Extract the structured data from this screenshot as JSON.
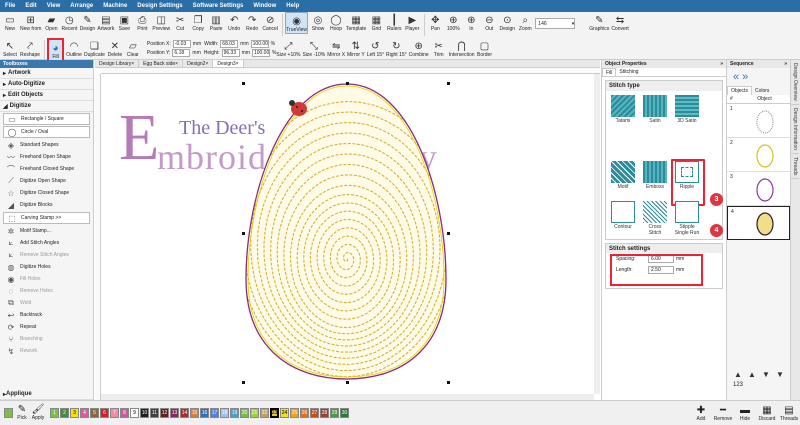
{
  "menu": [
    "File",
    "Edit",
    "View",
    "Arrange",
    "Machine",
    "Design Settings",
    "Software Settings",
    "Window",
    "Help"
  ],
  "toolbar1": [
    {
      "label": "New",
      "icon": "new-icon"
    },
    {
      "label": "New from",
      "icon": "new-from-icon"
    },
    {
      "label": "Open",
      "icon": "open-icon"
    },
    {
      "label": "Recent",
      "icon": "recent-icon"
    },
    {
      "label": "Design",
      "icon": "design-icon"
    },
    {
      "label": "Artwork",
      "icon": "artwork-icon"
    },
    {
      "label": "Save",
      "icon": "save-icon"
    },
    {
      "label": "Print",
      "icon": "print-icon"
    },
    {
      "label": "Preview",
      "icon": "preview-icon"
    },
    {
      "label": "Cut",
      "icon": "cut-icon"
    },
    {
      "label": "Copy",
      "icon": "copy-icon"
    },
    {
      "label": "Paste",
      "icon": "paste-icon"
    },
    {
      "label": "Undo",
      "icon": "undo-icon"
    },
    {
      "label": "Redo",
      "icon": "redo-icon"
    },
    {
      "label": "Cancel",
      "icon": "cancel-icon"
    },
    {
      "label": "TrueView",
      "icon": "trueview-icon"
    },
    {
      "label": "Show",
      "icon": "show-icon"
    },
    {
      "label": "Hoop",
      "icon": "hoop-icon"
    },
    {
      "label": "Template",
      "icon": "template-icon"
    },
    {
      "label": "Grid",
      "icon": "grid-icon"
    },
    {
      "label": "Rulers",
      "icon": "rulers-icon"
    },
    {
      "label": "Player",
      "icon": "player-icon"
    },
    {
      "label": "Pan",
      "icon": "pan-icon"
    },
    {
      "label": "100%",
      "icon": "zoom100-icon"
    },
    {
      "label": "In",
      "icon": "zoom-in-icon"
    },
    {
      "label": "Out",
      "icon": "zoom-out-icon"
    },
    {
      "label": "Design",
      "icon": "zoom-design-icon"
    },
    {
      "label": "Zoom",
      "icon": "zoom-icon"
    }
  ],
  "zoom_value": "146",
  "toolbar1_right": [
    {
      "label": "Graphics",
      "icon": "graphics-icon"
    },
    {
      "label": "Convert",
      "icon": "convert-icon"
    }
  ],
  "toolbar2": [
    {
      "label": "Select",
      "icon": "select-icon"
    },
    {
      "label": "Reshape",
      "icon": "reshape-icon"
    },
    {
      "label": "Fill",
      "icon": "fill-icon"
    },
    {
      "label": "Outline",
      "icon": "outline-icon"
    },
    {
      "label": "Duplicate",
      "icon": "duplicate-icon"
    },
    {
      "label": "Delete",
      "icon": "delete-icon"
    },
    {
      "label": "Clear",
      "icon": "clear-icon"
    }
  ],
  "position": {
    "x_label": "Position X:",
    "x_value": "-0.03",
    "y_label": "Position Y:",
    "y_value": "6.18",
    "unit": "mm",
    "w_label": "Width:",
    "w_value": "68.03",
    "h_label": "Height:",
    "h_value": "96.33",
    "w_pct": "100.00",
    "h_pct": "100.00",
    "pct": "%"
  },
  "toolbar2_right": [
    {
      "label": "Size +10%",
      "icon": "size-up-icon"
    },
    {
      "label": "Size -10%",
      "icon": "size-down-icon"
    },
    {
      "label": "Mirror X",
      "icon": "mirror-x-icon"
    },
    {
      "label": "Mirror Y",
      "icon": "mirror-y-icon"
    },
    {
      "label": "Left 15°",
      "icon": "rotate-left-icon"
    },
    {
      "label": "Right 15°",
      "icon": "rotate-right-icon"
    },
    {
      "label": "Combine",
      "icon": "combine-icon"
    },
    {
      "label": "Trim",
      "icon": "trim-icon"
    },
    {
      "label": "Intersection",
      "icon": "intersection-icon"
    },
    {
      "label": "Border",
      "icon": "border-icon"
    }
  ],
  "toolboxes": {
    "title": "Toolboxes",
    "sections": [
      "Artwork",
      "Auto-Digitize",
      "Edit Objects",
      "Digitize"
    ],
    "items": [
      {
        "label": "Rectangle / Square",
        "icon": "rectangle-icon",
        "hl": true
      },
      {
        "label": "Circle / Oval",
        "icon": "circle-icon",
        "hl": true
      },
      {
        "label": "Standard Shapes",
        "icon": "shapes-icon",
        "hl": false
      },
      {
        "label": "Freehand Open Shape",
        "icon": "freehand-open-icon",
        "hl": false
      },
      {
        "label": "Freehand Closed Shape",
        "icon": "freehand-closed-icon",
        "hl": false
      },
      {
        "label": "Digitize Open Shape",
        "icon": "digitize-open-icon",
        "hl": false
      },
      {
        "label": "Digitize Closed Shape",
        "icon": "digitize-closed-icon",
        "hl": false
      },
      {
        "label": "Digitize Blocks",
        "icon": "digitize-blocks-icon",
        "hl": false
      },
      {
        "label": "Carving Stamp >>",
        "icon": "carving-stamp-icon",
        "hl": true
      },
      {
        "label": "Motif Stamp...",
        "icon": "motif-stamp-icon",
        "hl": false
      },
      {
        "label": "Add Stitch Angles",
        "icon": "add-angles-icon",
        "hl": false
      },
      {
        "label": "Remove Stitch Angles",
        "icon": "remove-angles-icon",
        "hl": false,
        "dim": true
      },
      {
        "label": "Digitize Holes",
        "icon": "digitize-holes-icon",
        "hl": false
      },
      {
        "label": "Fill Holes",
        "icon": "fill-holes-icon",
        "hl": false,
        "dim": true
      },
      {
        "label": "Remove Holes",
        "icon": "remove-holes-icon",
        "hl": false,
        "dim": true
      },
      {
        "label": "Weld",
        "icon": "weld-icon",
        "hl": false,
        "dim": true
      },
      {
        "label": "Backtrack",
        "icon": "backtrack-icon",
        "hl": false
      },
      {
        "label": "Repeat",
        "icon": "repeat-icon",
        "hl": false
      },
      {
        "label": "Branching",
        "icon": "branching-icon",
        "hl": false,
        "dim": true
      },
      {
        "label": "Rework",
        "icon": "rework-icon",
        "hl": false,
        "dim": true
      }
    ],
    "bottom_section": "Applique"
  },
  "doc_tabs": [
    "Design Library",
    "Egg Back side",
    "Design2",
    "Design3"
  ],
  "logo": {
    "line1": "The Deer's",
    "big_e": "E",
    "line2": "mbroidery Legacy"
  },
  "object_properties": {
    "title": "Object Properties",
    "tabs": [
      "Fill",
      "Stitching"
    ],
    "stitch_type_label": "Stitch type",
    "types": [
      "Tatami",
      "Satin",
      "3D Satin",
      "Motif",
      "Emboss",
      "Ripple",
      "Contour",
      "Cross Stitch",
      "Stipple Single Run"
    ],
    "settings_label": "Stitch settings",
    "spacing_label": "Spacing:",
    "spacing_value": "6.00",
    "length_label": "Length:",
    "length_value": "2.50",
    "unit": "mm"
  },
  "badges": [
    "3",
    "4"
  ],
  "sequence": {
    "title": "Sequence",
    "tabs": [
      "Objects",
      "Colors"
    ],
    "col_num": "#",
    "col_obj": "Object",
    "rows": [
      "1",
      "2",
      "3",
      "4"
    ],
    "numbers_label": "123"
  },
  "side_tabs": [
    "Design Overview",
    "Design Information",
    "Threads"
  ],
  "colors": {
    "swatches": [
      {
        "n": "1",
        "c": "#7bc043"
      },
      {
        "n": "2",
        "c": "#3f8f3f"
      },
      {
        "n": "3",
        "c": "#f5e010"
      },
      {
        "n": "4",
        "c": "#e05a9a"
      },
      {
        "n": "5",
        "c": "#8a6a3a"
      },
      {
        "n": "6",
        "c": "#d0202a"
      },
      {
        "n": "7",
        "c": "#f08aa5"
      },
      {
        "n": "8",
        "c": "#c0609a"
      },
      {
        "n": "9",
        "c": "#ffffff"
      },
      {
        "n": "10",
        "c": "#202020"
      },
      {
        "n": "11",
        "c": "#404040"
      },
      {
        "n": "12",
        "c": "#602020"
      },
      {
        "n": "13",
        "c": "#8a2a5a"
      },
      {
        "n": "14",
        "c": "#b02a2a"
      },
      {
        "n": "15",
        "c": "#d08040"
      },
      {
        "n": "16",
        "c": "#3070c0"
      },
      {
        "n": "17",
        "c": "#5080e0"
      },
      {
        "n": "18",
        "c": "#a0c0f0"
      },
      {
        "n": "19",
        "c": "#4aa0d0"
      },
      {
        "n": "20",
        "c": "#70c040"
      },
      {
        "n": "21",
        "c": "#a0d040"
      },
      {
        "n": "22",
        "c": "#c0a060"
      },
      {
        "n": "23",
        "c": "#e0c050"
      },
      {
        "n": "24",
        "c": "#f0e020"
      },
      {
        "n": "25",
        "c": "#f0a020"
      },
      {
        "n": "26",
        "c": "#e07020"
      },
      {
        "n": "27",
        "c": "#c05020"
      },
      {
        "n": "28",
        "c": "#a04030"
      },
      {
        "n": "29",
        "c": "#4a9a4a"
      },
      {
        "n": "30",
        "c": "#2a7a3a"
      }
    ],
    "selected": "23",
    "pick_label": "Pick",
    "apply_label": "Apply"
  },
  "bottom_right": [
    {
      "label": "Add",
      "icon": "add-icon"
    },
    {
      "label": "Remove",
      "icon": "remove-icon"
    },
    {
      "label": "Hide",
      "icon": "hide-icon"
    },
    {
      "label": "Discard",
      "icon": "discard-icon"
    },
    {
      "label": "Threads",
      "icon": "threads-icon"
    }
  ]
}
